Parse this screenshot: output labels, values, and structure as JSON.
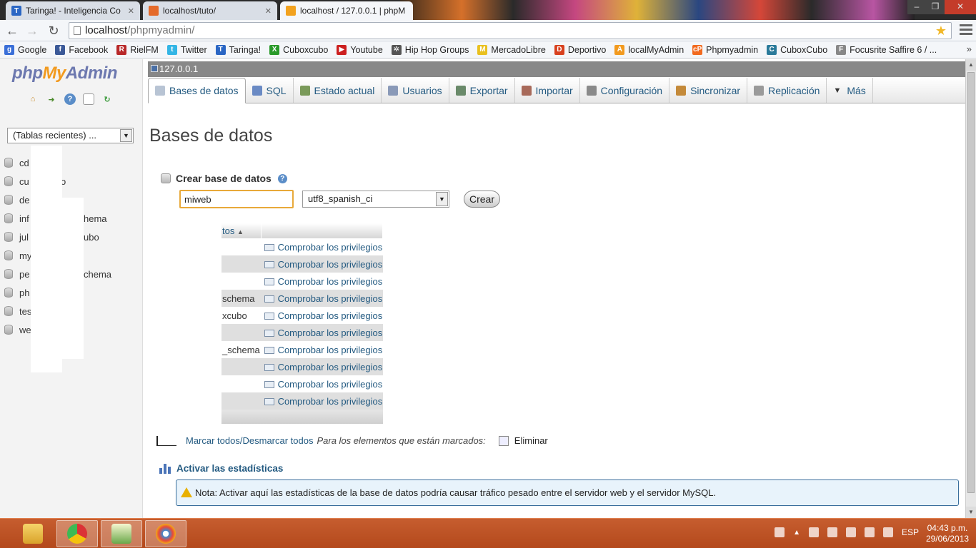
{
  "browser": {
    "tabs": [
      {
        "title": "Taringa! - Inteligencia Co",
        "icon": "taringa-icon",
        "color": "#2a66c4",
        "glyph": "T"
      },
      {
        "title": "localhost/tuto/",
        "icon": "page-icon",
        "color": "#e46a2a",
        "glyph": ""
      },
      {
        "title": "localhost / 127.0.0.1 | phpM",
        "icon": "phpmyadmin-icon",
        "color": "#f2a21f",
        "glyph": ""
      }
    ],
    "url_host": "localhost",
    "url_path": "/phpmyadmin/",
    "bookmarks": [
      {
        "label": "Google",
        "color": "#3a6fd8",
        "glyph": "g"
      },
      {
        "label": "Facebook",
        "color": "#3b5998",
        "glyph": "f"
      },
      {
        "label": "RielFM",
        "color": "#b8282a",
        "glyph": "R"
      },
      {
        "label": "Twitter",
        "color": "#33b5e5",
        "glyph": "t"
      },
      {
        "label": "Taringa!",
        "color": "#2a66c4",
        "glyph": "T"
      },
      {
        "label": "Cuboxcubo",
        "color": "#2a9a2a",
        "glyph": "X"
      },
      {
        "label": "Youtube",
        "color": "#cc1f1f",
        "glyph": "▶"
      },
      {
        "label": "Hip Hop Groups",
        "color": "#555555",
        "glyph": "✲"
      },
      {
        "label": "MercadoLibre",
        "color": "#e9c01e",
        "glyph": "M"
      },
      {
        "label": "Deportivo",
        "color": "#d8401e",
        "glyph": "D"
      },
      {
        "label": "localMyAdmin",
        "color": "#f29a1f",
        "glyph": "A"
      },
      {
        "label": "Phpmyadmin",
        "color": "#f26a1f",
        "glyph": "cP"
      },
      {
        "label": "CuboxCubo",
        "color": "#2a7a9a",
        "glyph": "C"
      },
      {
        "label": "Focusrite Saffire 6 / ...",
        "color": "#888888",
        "glyph": "F"
      }
    ]
  },
  "sidebar": {
    "logo": {
      "php": "php",
      "my": "My",
      "admin": "Admin"
    },
    "recent_select": "(Tablas recientes) ...",
    "databases": [
      "cd",
      "cu",
      "de",
      "inf",
      "jul",
      "my",
      "pe",
      "ph",
      "tes",
      "we"
    ],
    "db_tails": {
      "cu": "o",
      "inf": "hema",
      "jul": "ubo",
      "pe": "chema"
    }
  },
  "main": {
    "server": "127.0.0.1",
    "tabs": [
      {
        "label": "Bases de datos",
        "active": true,
        "color": "#b8c4d4"
      },
      {
        "label": "SQL",
        "color": "#6a8ac4"
      },
      {
        "label": "Estado actual",
        "color": "#7a9a5a"
      },
      {
        "label": "Usuarios",
        "color": "#8a9ab8"
      },
      {
        "label": "Exportar",
        "color": "#6a8a6a"
      },
      {
        "label": "Importar",
        "color": "#a86a5a"
      },
      {
        "label": "Configuración",
        "color": "#8a8a8a"
      },
      {
        "label": "Sincronizar",
        "color": "#c48a3a"
      },
      {
        "label": "Replicación",
        "color": "#9a9a9a"
      },
      {
        "label": "Más",
        "color": ""
      }
    ],
    "title": "Bases de datos",
    "create_label": "Crear base de datos",
    "new_db_value": "miweb",
    "collation": "utf8_spanish_ci",
    "create_button": "Crear",
    "table_header": "tos",
    "table_rows": [
      {
        "name": "",
        "priv": "Comprobar los privilegios"
      },
      {
        "name": "",
        "priv": "Comprobar los privilegios"
      },
      {
        "name": "",
        "priv": "Comprobar los privilegios"
      },
      {
        "name": "schema",
        "priv": "Comprobar los privilegios"
      },
      {
        "name": "xcubo",
        "priv": "Comprobar los privilegios"
      },
      {
        "name": "",
        "priv": "Comprobar los privilegios"
      },
      {
        "name": "_schema",
        "priv": "Comprobar los privilegios"
      },
      {
        "name": "",
        "priv": "Comprobar los privilegios"
      },
      {
        "name": "",
        "priv": "Comprobar los privilegios"
      },
      {
        "name": "",
        "priv": "Comprobar los privilegios"
      }
    ],
    "check_all": "Marcar todos",
    "slash": " / ",
    "uncheck_all": "Desmarcar todos",
    "with_selected": "Para los elementos que están marcados:",
    "delete": "Eliminar",
    "stats_link": "Activar las estadísticas",
    "notice": "Nota: Activar aquí las estadísticas de la base de datos podría causar tráfico pesado entre el servidor web y el servidor MySQL."
  },
  "taskbar": {
    "lang": "ESP",
    "time": "04:43 p.m.",
    "date": "29/06/2013"
  }
}
